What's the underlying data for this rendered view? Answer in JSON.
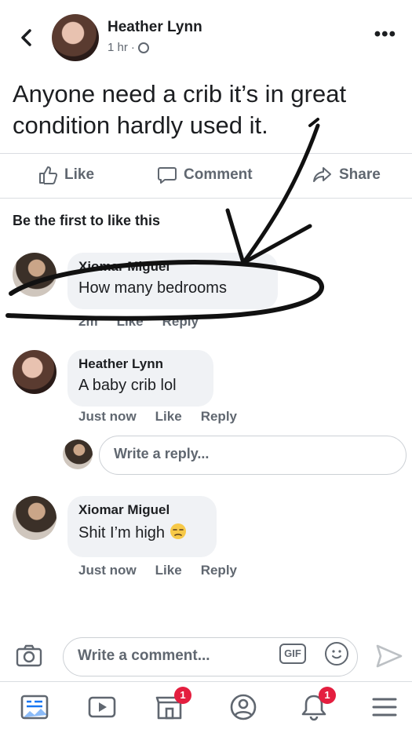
{
  "post": {
    "author": "Heather Lynn",
    "time": "1 hr",
    "separator": "·",
    "text": "Anyone need a crib it’s in great condition hardly used it."
  },
  "actions": {
    "like": "Like",
    "comment": "Comment",
    "share": "Share"
  },
  "likes_text": "Be the first to like this",
  "comments": [
    {
      "name": "Xiomar Miguel",
      "text": "How many bedrooms",
      "time": "2m",
      "like": "Like",
      "reply": "Reply"
    },
    {
      "name": "Heather Lynn",
      "text": "A baby crib lol",
      "time": "Just now",
      "like": "Like",
      "reply": "Reply"
    },
    {
      "name": "Xiomar Miguel",
      "text": "Shit I’m high",
      "time": "Just now",
      "like": "Like",
      "reply": "Reply"
    }
  ],
  "reply_placeholder": "Write a reply...",
  "composer": {
    "placeholder": "Write a comment...",
    "gif": "GIF"
  },
  "tabs": [
    {
      "icon": "news-feed-icon"
    },
    {
      "icon": "watch-icon"
    },
    {
      "icon": "marketplace-icon",
      "badge": "1"
    },
    {
      "icon": "profile-icon"
    },
    {
      "icon": "notifications-icon",
      "badge": "1"
    },
    {
      "icon": "menu-icon"
    }
  ],
  "colors": {
    "text": "#1c1e21",
    "secondary": "#606770",
    "bubble": "#f0f2f5",
    "badge": "#e41e3f",
    "accent_send": "#bcc0c4"
  }
}
